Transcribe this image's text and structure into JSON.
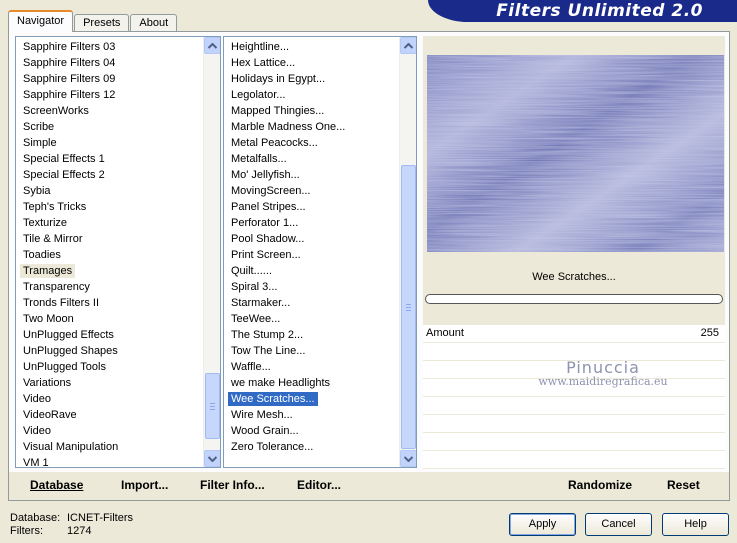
{
  "title": "Filters Unlimited 2.0",
  "tabs": [
    {
      "label": "Navigator",
      "active": true
    },
    {
      "label": "Presets",
      "active": false
    },
    {
      "label": "About",
      "active": false
    }
  ],
  "categories": {
    "items": [
      "Sapphire Filters 03",
      "Sapphire Filters 04",
      "Sapphire Filters 09",
      "Sapphire Filters 12",
      "ScreenWorks",
      "Scribe",
      "Simple",
      "Special Effects 1",
      "Special Effects 2",
      "Sybia",
      "Teph's Tricks",
      "Texturize",
      "Tile & Mirror",
      "Toadies",
      "Tramages",
      "Transparency",
      "Tronds Filters II",
      "Two Moon",
      "UnPlugged Effects",
      "UnPlugged Shapes",
      "UnPlugged Tools",
      "Variations",
      "Video",
      "VideoRave",
      "Video",
      "Visual Manipulation",
      "VM 1"
    ],
    "selected": "Tramages"
  },
  "filters": {
    "items": [
      "Heightline...",
      "Hex Lattice...",
      "Holidays in Egypt...",
      "Legolator...",
      "Mapped Thingies...",
      "Marble Madness One...",
      "Metal Peacocks...",
      "Metalfalls...",
      "Mo' Jellyfish...",
      "MovingScreen...",
      "Panel Stripes...",
      "Perforator 1...",
      "Pool Shadow...",
      "Print Screen...",
      "Quilt......",
      "Spiral 3...",
      "Starmaker...",
      "TeeWee...",
      "The Stump 2...",
      "Tow The Line...",
      "Waffle...",
      "we make Headlights",
      "Wee Scratches...",
      "Wire Mesh...",
      "Wood Grain...",
      "Zero Tolerance..."
    ],
    "selected": "Wee Scratches..."
  },
  "preview": {
    "filter_name": "Wee Scratches...",
    "params": [
      {
        "label": "Amount",
        "value": "255"
      }
    ],
    "watermark_name": "Pinuccia",
    "watermark_url": "www.maidiregrafica.eu"
  },
  "toolbar": {
    "database": "Database",
    "import": "Import...",
    "filter_info": "Filter Info...",
    "editor": "Editor...",
    "randomize": "Randomize",
    "reset": "Reset"
  },
  "status": {
    "database_label": "Database:",
    "database_value": "ICNET-Filters",
    "filters_label": "Filters:",
    "filters_value": "1274"
  },
  "buttons": {
    "apply": "Apply",
    "cancel": "Cancel",
    "help": "Help"
  },
  "colors": {
    "title_banner": "#1a2a8a",
    "selection": "#316ac5",
    "tab_accent": "#e68b2c",
    "preview_texture": "#8c92c4"
  }
}
